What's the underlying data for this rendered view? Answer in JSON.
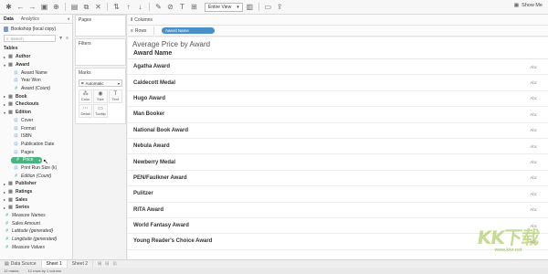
{
  "toolbar": {
    "view_select": "Entire View",
    "show_me": "Show Me"
  },
  "data_pane": {
    "tab_data": "Data",
    "tab_analytics": "Analytics",
    "datasource": "Bookshop (local copy)",
    "search_placeholder": "Search",
    "tables_label": "Tables",
    "tree": [
      {
        "type": "table",
        "label": "Author",
        "open": false
      },
      {
        "type": "table",
        "label": "Award",
        "open": true
      },
      {
        "type": "dim",
        "label": "Award Name"
      },
      {
        "type": "dim",
        "label": "Year Won"
      },
      {
        "type": "mea",
        "label": "Award (Count)",
        "italic": true
      },
      {
        "type": "table",
        "label": "Book",
        "open": false
      },
      {
        "type": "table",
        "label": "Checkouts",
        "open": false
      },
      {
        "type": "table",
        "label": "Edition",
        "open": true
      },
      {
        "type": "dim",
        "label": "Cover"
      },
      {
        "type": "dim",
        "label": "Format"
      },
      {
        "type": "dim",
        "label": "ISBN"
      },
      {
        "type": "dim",
        "label": "Publication Date"
      },
      {
        "type": "dim",
        "label": "Pages"
      },
      {
        "type": "pill",
        "label": "Price"
      },
      {
        "type": "dim",
        "label": "Print Run Size (k)"
      },
      {
        "type": "mea",
        "label": "Edition (Count)",
        "italic": true
      },
      {
        "type": "table",
        "label": "Publisher",
        "open": false
      },
      {
        "type": "table",
        "label": "Ratings",
        "open": false
      },
      {
        "type": "table",
        "label": "Sales",
        "open": false
      },
      {
        "type": "table",
        "label": "Series",
        "open": false
      },
      {
        "type": "measure",
        "label": "Measure Names",
        "italic": true
      },
      {
        "type": "measure",
        "label": "Sales Amount"
      },
      {
        "type": "measure",
        "label": "Latitude (generated)",
        "italic": true
      },
      {
        "type": "measure",
        "label": "Longitude (generated)",
        "italic": true
      },
      {
        "type": "measure",
        "label": "Measure Values",
        "italic": true
      }
    ]
  },
  "cards": {
    "pages": "Pages",
    "filters": "Filters",
    "marks": "Marks",
    "marks_type": "Automatic",
    "buttons": [
      {
        "label": "Color",
        "icon": "color-icon"
      },
      {
        "label": "Size",
        "icon": "size-icon"
      },
      {
        "label": "Text",
        "icon": "text-icon"
      },
      {
        "label": "Detail",
        "icon": "detail-icon"
      },
      {
        "label": "Tooltip",
        "icon": "tooltip-icon"
      }
    ]
  },
  "shelves": {
    "columns": "Columns",
    "rows": "Rows",
    "rows_pill": "Award Name"
  },
  "view": {
    "title": "Average Price by Award",
    "header": "Award Name",
    "placeholder": "Abc",
    "rows": [
      "Agatha Award",
      "Caldecott Medal",
      "Hugo Award",
      "Man Booker",
      "National Book Award",
      "Nebula Award",
      "Newberry Medal",
      "PEN/Faulkner Award",
      "Pulitzer",
      "RITA Award",
      "World Fantasy Award",
      "Young Reader's Choice Award"
    ]
  },
  "sheet_tabs": {
    "data_source": "Data Source",
    "sheet1": "Sheet 1",
    "sheet2": "Sheet 2"
  },
  "status": {
    "marks": "12 marks",
    "rows_cols": "12 rows by 1 column"
  },
  "watermark": {
    "logo": "KK下载",
    "url": "www.kkx.net"
  }
}
